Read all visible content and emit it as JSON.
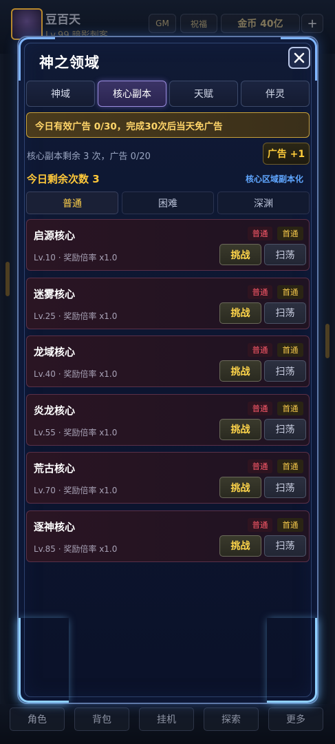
{
  "background": {
    "player_name": "豆百天",
    "player_level": "Lv.99 暗影刺客",
    "gm_label": "GM",
    "bless_label": "祝福",
    "coin_label": "金币 40亿",
    "plus_label": "+",
    "bottom_nav": [
      "角色",
      "背包",
      "挂机",
      "探索",
      "更多"
    ]
  },
  "modal": {
    "title": "神之领域",
    "close_icon": "close-icon",
    "tabs": [
      {
        "label": "神域",
        "active": false
      },
      {
        "label": "核心副本",
        "active": true
      },
      {
        "label": "天赋",
        "active": false
      },
      {
        "label": "伴灵",
        "active": false
      }
    ],
    "ad_notice": "今日有效广告 0/30，完成30次后当天免广告",
    "remain_info": "核心副本剩余 3 次，广告 0/20",
    "ad_bonus_button": "广告 +1",
    "today_remaining": "今日剩余次数 3",
    "core_link": "核心区域副本化",
    "difficulties": [
      {
        "label": "普通",
        "active": true
      },
      {
        "label": "困难",
        "active": false
      },
      {
        "label": "深渊",
        "active": false
      }
    ],
    "dungeons": [
      {
        "name": "启源核心",
        "info": "Lv.10 · 奖励倍率 x1.0",
        "tag_normal": "普通",
        "tag_first": "首通",
        "challenge": "挑战",
        "sweep": "扫荡"
      },
      {
        "name": "迷雾核心",
        "info": "Lv.25 · 奖励倍率 x1.0",
        "tag_normal": "普通",
        "tag_first": "首通",
        "challenge": "挑战",
        "sweep": "扫荡"
      },
      {
        "name": "龙域核心",
        "info": "Lv.40 · 奖励倍率 x1.0",
        "tag_normal": "普通",
        "tag_first": "首通",
        "challenge": "挑战",
        "sweep": "扫荡"
      },
      {
        "name": "炎龙核心",
        "info": "Lv.55 · 奖励倍率 x1.0",
        "tag_normal": "普通",
        "tag_first": "首通",
        "challenge": "挑战",
        "sweep": "扫荡"
      },
      {
        "name": "荒古核心",
        "info": "Lv.70 · 奖励倍率 x1.0",
        "tag_normal": "普通",
        "tag_first": "首通",
        "challenge": "挑战",
        "sweep": "扫荡"
      },
      {
        "name": "逐神核心",
        "info": "Lv.85 · 奖励倍率 x1.0",
        "tag_normal": "普通",
        "tag_first": "首通",
        "challenge": "挑战",
        "sweep": "扫荡"
      }
    ]
  },
  "colors": {
    "accent_gold": "#ffc83a",
    "accent_blue": "#5fa6ff",
    "tag_red": "#ff5a6a",
    "card_border": "#5a3048"
  }
}
